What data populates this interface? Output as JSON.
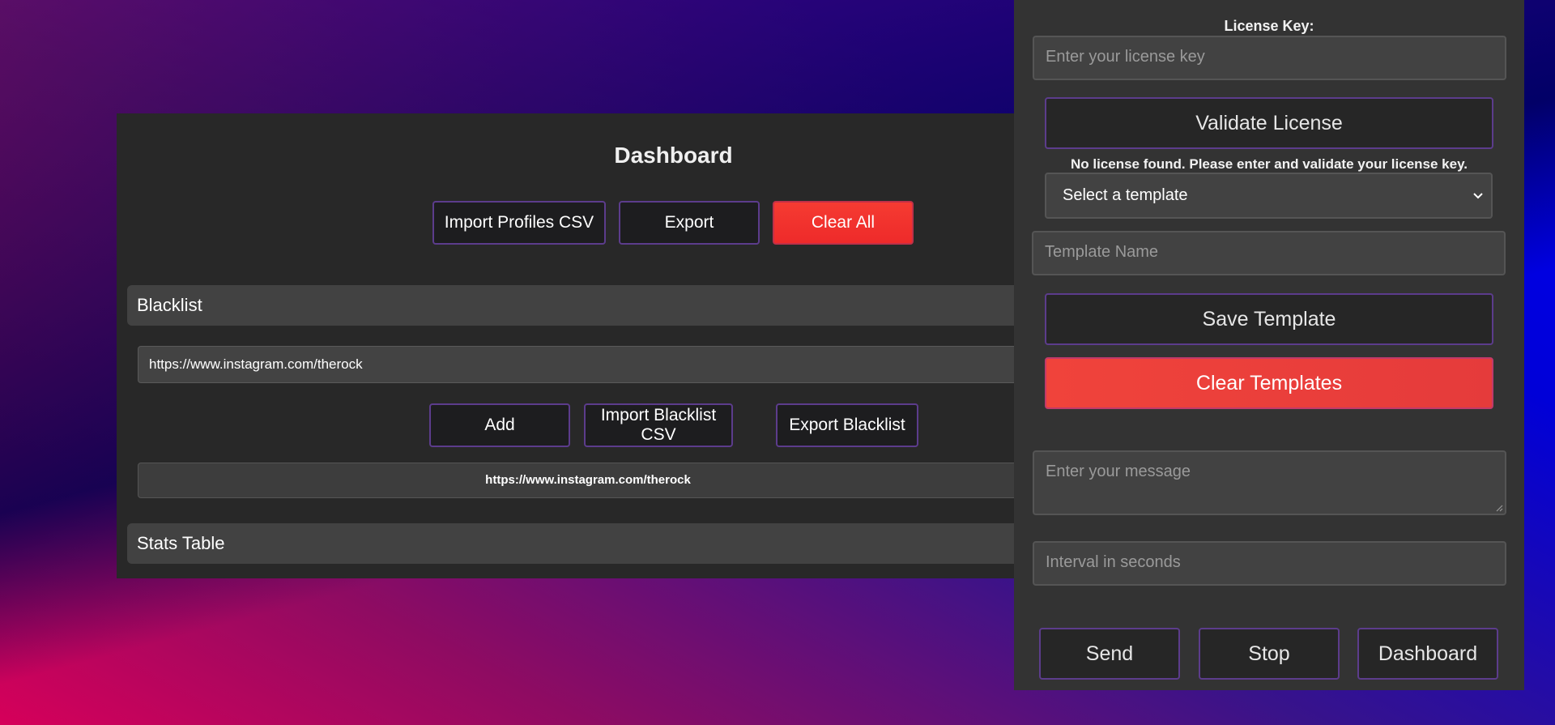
{
  "dashboard": {
    "title": "Dashboard",
    "import_profiles_label": "Import Profiles CSV",
    "export_label": "Export",
    "clear_all_label": "Clear All",
    "blacklist": {
      "header": "Blacklist",
      "input_value": "https://www.instagram.com/therock",
      "add_label": "Add",
      "import_label": "Import Blacklist CSV",
      "export_label": "Export Blacklist",
      "items": [
        "https://www.instagram.com/therock"
      ]
    },
    "stats_header": "Stats Table"
  },
  "side": {
    "license_label": "License Key:",
    "license_placeholder": "Enter your license key",
    "validate_label": "Validate License",
    "status_message": "No license found. Please enter and validate your license key.",
    "template_select_value": "Select a template",
    "template_name_placeholder": "Template Name",
    "save_template_label": "Save Template",
    "clear_templates_label": "Clear Templates",
    "message_placeholder": "Enter your message",
    "interval_placeholder": "Interval in seconds",
    "send_label": "Send",
    "stop_label": "Stop",
    "dashboard_label": "Dashboard"
  },
  "colors": {
    "accent_red": "#f03a32",
    "button_border": "#5c3c8c",
    "panel_bg": "#282828",
    "side_bg": "#333333"
  },
  "icons": {
    "select_chevron": "chevron-down-icon",
    "textarea_resize": "resize-handle-icon"
  }
}
